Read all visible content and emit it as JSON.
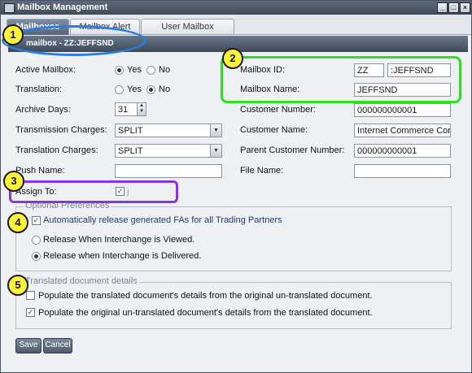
{
  "window": {
    "title": "Mailbox Management",
    "controls": [
      "_",
      "□",
      "×"
    ]
  },
  "tabs": [
    {
      "label": "Mailboxes"
    },
    {
      "label": "Mailbox Alert Rules"
    },
    {
      "label": "User Mailbox Assignments"
    }
  ],
  "panel": {
    "title": "mailbox - ZZ:JEFFSND"
  },
  "form": {
    "active_mailbox": {
      "label": "Active Mailbox:",
      "yes": "Yes",
      "no": "No",
      "selected": "Yes"
    },
    "translation": {
      "label": "Translation:",
      "yes": "Yes",
      "no": "No",
      "selected": "No"
    },
    "archive_days": {
      "label": "Archive Days:",
      "value": "31"
    },
    "transmission_charges": {
      "label": "Transmission Charges:",
      "value": "SPLIT"
    },
    "translation_charges": {
      "label": "Translation Charges:",
      "value": "SPLIT"
    },
    "push_name": {
      "label": "Push Name:",
      "value": ""
    },
    "assign_to": {
      "label": "Assign To:",
      "checked": true,
      "value": "j"
    },
    "mailbox_id": {
      "label": "Mailbox ID:",
      "qualifier": "ZZ",
      "sep": ":",
      "id": "JEFFSND"
    },
    "mailbox_name": {
      "label": "Mailbox Name:",
      "value": "JEFFSND"
    },
    "customer_number": {
      "label": "Customer Number:",
      "value": "000000000001"
    },
    "customer_name": {
      "label": "Customer Name:",
      "value": "Internet Commerce Corpor"
    },
    "parent_customer_number": {
      "label": "Parent Customer Number:",
      "value": "000000000001"
    },
    "file_name": {
      "label": "File Name:",
      "value": ""
    }
  },
  "optional_preferences": {
    "legend": "Optional Preferences",
    "auto_release": {
      "label": "Automatically release generated FAs for all Trading Partners",
      "checked": true
    },
    "release_viewed": {
      "label": "Release When Interchange is Viewed.",
      "selected": false
    },
    "release_delivered": {
      "label": "Release when Interchange is Delivered.",
      "selected": true
    }
  },
  "translated_details": {
    "legend": "Translated document details",
    "populate_translated": {
      "label": "Populate the translated document's details from the original un-translated document.",
      "checked": false
    },
    "populate_original": {
      "label": "Populate the original un-translated document's details from the translated document.",
      "checked": true
    }
  },
  "buttons": {
    "save": "Save",
    "cancel": "Cancel"
  },
  "callouts": [
    "1",
    "2",
    "3",
    "4",
    "5"
  ],
  "colors": {
    "callout_fill": "#fff43a",
    "ring_blue": "#2d7de0",
    "ring_green": "#2ee01a",
    "ring_purple": "#8a35e3"
  }
}
